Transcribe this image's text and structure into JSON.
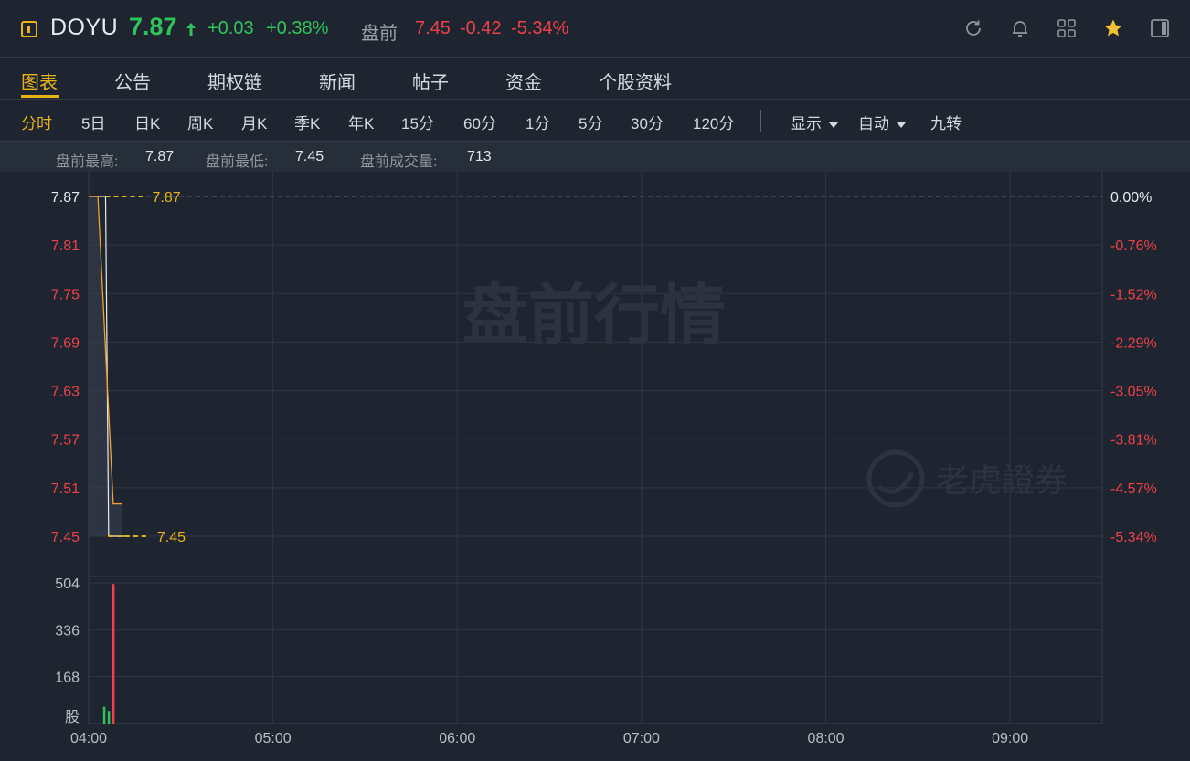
{
  "header": {
    "symbol": "DOYU",
    "price": "7.87",
    "change": "+0.03",
    "change_pct": "+0.38%",
    "premarket_label": "盘前",
    "premarket_price": "7.45",
    "premarket_change": "-0.42",
    "premarket_change_pct": "-5.34%",
    "icons": [
      "refresh-icon",
      "bell-icon",
      "grid-icon",
      "star-icon",
      "sidebar-icon"
    ]
  },
  "tabs": [
    "图表",
    "公告",
    "期权链",
    "新闻",
    "帖子",
    "资金",
    "个股资料"
  ],
  "toolbar": {
    "periods": [
      "分时",
      "5日",
      "日K",
      "周K",
      "月K",
      "季K",
      "年K",
      "15分",
      "60分",
      "1分",
      "5分",
      "30分",
      "120分"
    ],
    "display_label": "显示",
    "auto_label": "自动",
    "nine_label": "九转"
  },
  "stats": {
    "high_label": "盘前最高:",
    "high_value": "7.87",
    "low_label": "盘前最低:",
    "low_value": "7.45",
    "volume_label": "盘前成交量:",
    "volume_value": "713"
  },
  "watermark": "盘前行情",
  "brand": "老虎證券",
  "colors": {
    "up": "#2ec45a",
    "down": "#f0404a",
    "accent": "#e7b416",
    "price_line": "#f0a030",
    "avg_line": "#e8eaed"
  },
  "chart_data": {
    "type": "line",
    "price_ticks": [
      "7.87",
      "7.81",
      "7.75",
      "7.69",
      "7.63",
      "7.57",
      "7.51",
      "7.45"
    ],
    "pct_ticks": [
      "0.00%",
      "-0.76%",
      "-1.52%",
      "-2.29%",
      "-3.05%",
      "-3.81%",
      "-4.57%",
      "-5.34%"
    ],
    "volume_ticks": [
      "504",
      "336",
      "168"
    ],
    "volume_unit": "股",
    "x_ticks": [
      "04:00",
      "05:00",
      "06:00",
      "07:00",
      "08:00",
      "09:00"
    ],
    "ylim": [
      7.45,
      7.87
    ],
    "volume_max": 504,
    "high_label": "7.87",
    "low_label": "7.45",
    "price_series": [
      {
        "t": 0.0,
        "v": 7.87
      },
      {
        "t": 3.0,
        "v": 7.87
      },
      {
        "t": 8.0,
        "v": 7.49
      },
      {
        "t": 11.0,
        "v": 7.49
      }
    ],
    "avg_series": [
      {
        "t": 0.0,
        "v": 7.87
      },
      {
        "t": 5.5,
        "v": 7.87
      },
      {
        "t": 6.5,
        "v": 7.45
      },
      {
        "t": 13.0,
        "v": 7.45
      }
    ],
    "volume_bars": [
      {
        "t": 5.0,
        "v": 60,
        "dir": "up"
      },
      {
        "t": 6.5,
        "v": 45,
        "dir": "up"
      },
      {
        "t": 8.0,
        "v": 500,
        "dir": "down"
      }
    ]
  }
}
